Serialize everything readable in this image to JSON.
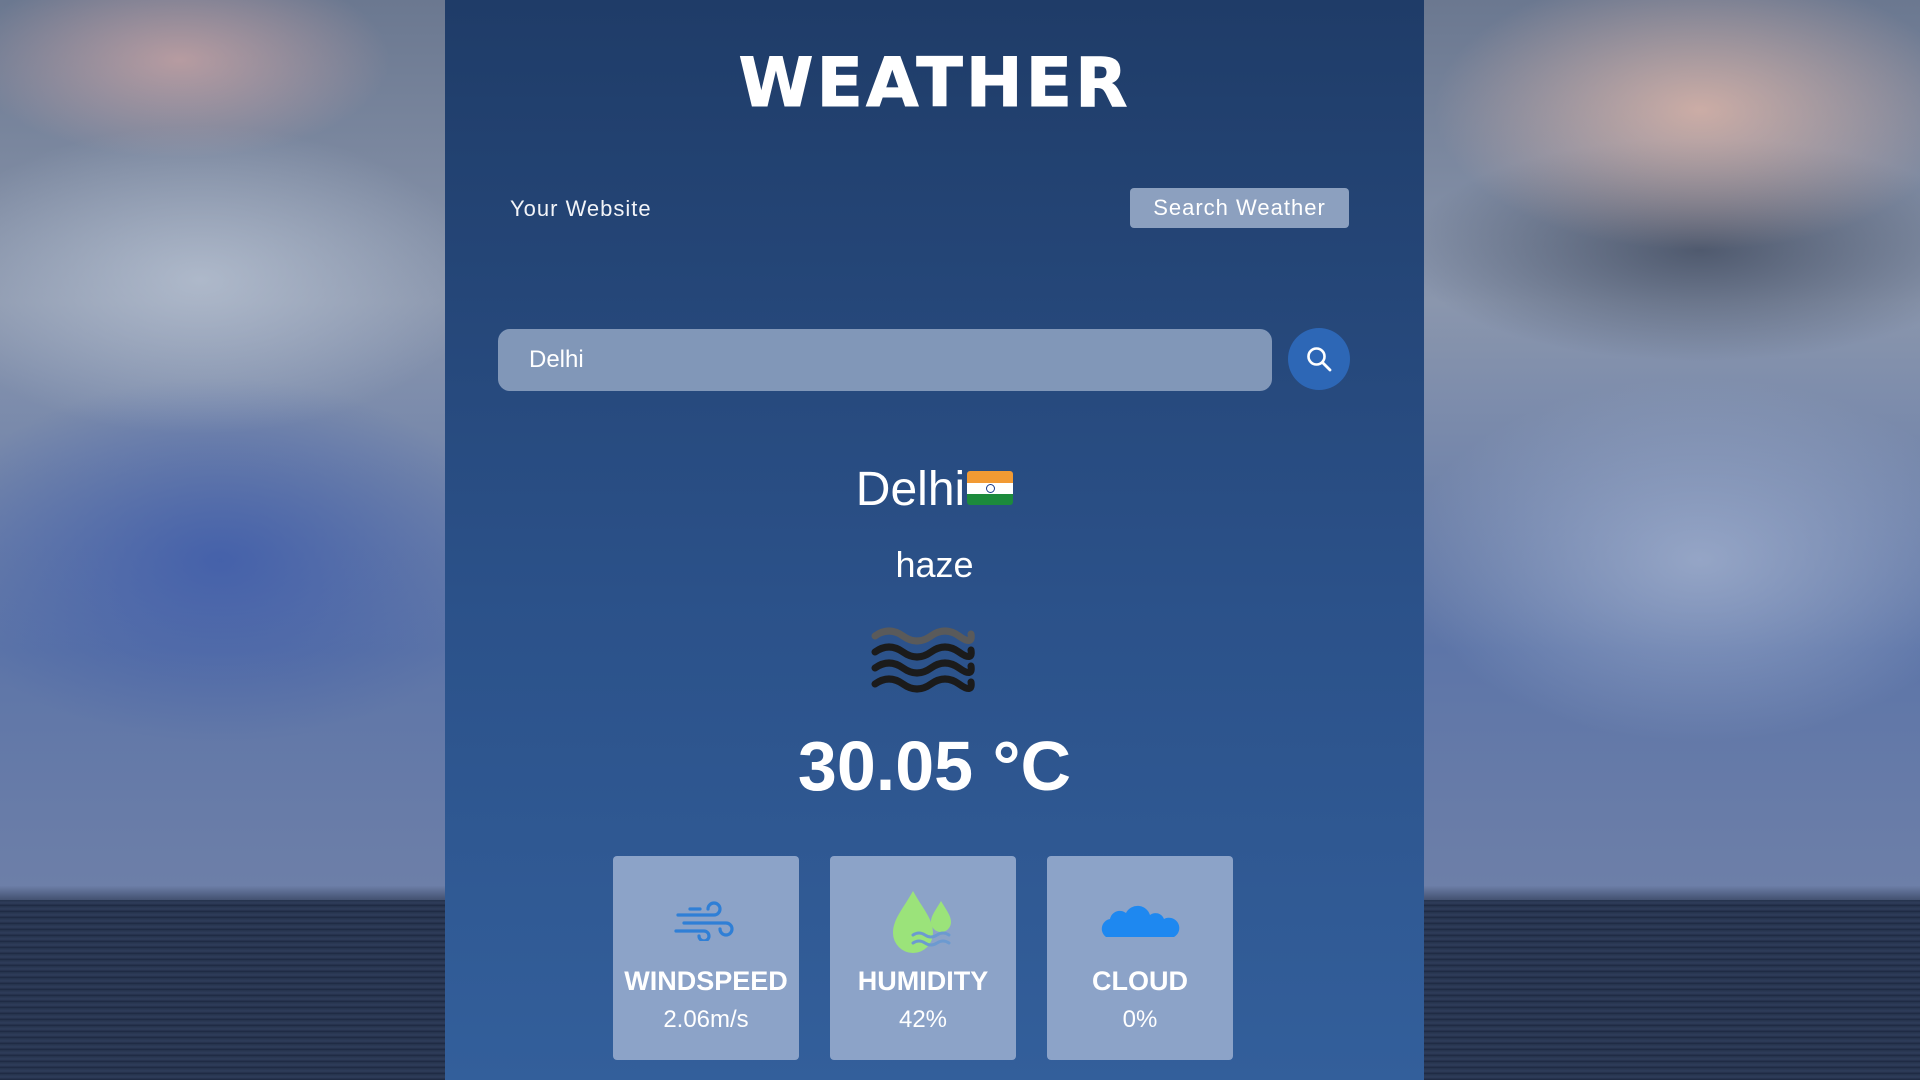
{
  "app": {
    "title": "WEATHER"
  },
  "nav": {
    "link_label": "Your Website",
    "button_label": "Search Weather"
  },
  "search": {
    "value": "Delhi",
    "placeholder": ""
  },
  "current": {
    "city": "Delhi",
    "country_flag": "india-flag-icon",
    "description": "haze",
    "condition_icon": "haze-icon",
    "temperature": "30.05 °C"
  },
  "stats": [
    {
      "label": "WINDSPEED",
      "value": "2.06m/s",
      "icon": "wind-icon"
    },
    {
      "label": "HUMIDITY",
      "value": "42%",
      "icon": "humidity-drops-icon"
    },
    {
      "label": "CLOUD",
      "value": "0%",
      "icon": "cloud-icon"
    }
  ],
  "colors": {
    "panel_top": "#1f3c68",
    "panel_bottom": "#335f9b",
    "card_bg": "#8ca3c8",
    "search_button": "#2d67b6",
    "wind_icon": "#2f7fd6",
    "humidity_icon": "#9be37a",
    "cloud_icon": "#1e88f0"
  }
}
